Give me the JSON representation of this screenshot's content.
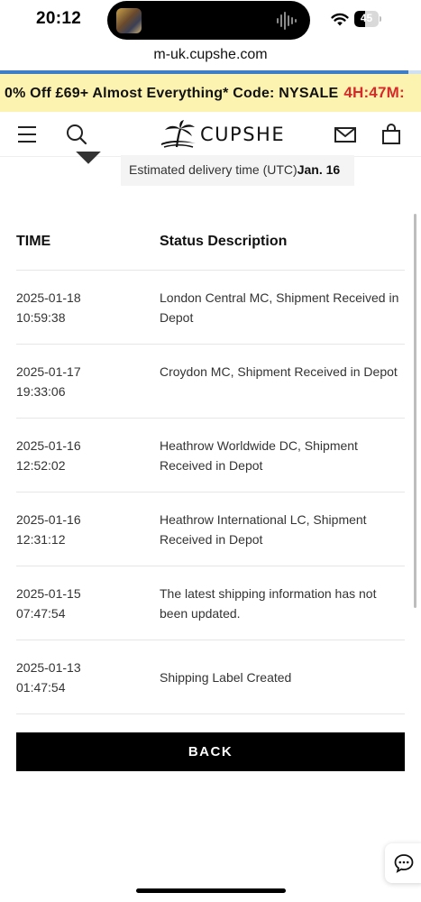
{
  "status_bar": {
    "time": "20:12",
    "battery_level": "45"
  },
  "browser": {
    "url": "m-uk.cupshe.com"
  },
  "promo": {
    "text": "0% Off £69+ Almost Everything* Code: NYSALE",
    "timer": "4H:47M:"
  },
  "header": {
    "menu_icon": "hamburger-menu-icon",
    "search_icon": "search-icon",
    "brand": "CUPSHE",
    "mail_icon": "mail-icon",
    "bag_icon": "shopping-bag-icon"
  },
  "delivery": {
    "label": "Estimated delivery time (UTC)",
    "date": "Jan. 16"
  },
  "tracking": {
    "columns": {
      "time": "TIME",
      "status": "Status Description"
    },
    "rows": [
      {
        "date": "2025-01-18",
        "clock": "10:59:38",
        "status": "London Central MC, Shipment Received in Depot"
      },
      {
        "date": "2025-01-17",
        "clock": "19:33:06",
        "status": "Croydon MC, Shipment Received in Depot"
      },
      {
        "date": "2025-01-16",
        "clock": "12:52:02",
        "status": "Heathrow Worldwide DC, Shipment Received in Depot"
      },
      {
        "date": "2025-01-16",
        "clock": "12:31:12",
        "status": "Heathrow International LC, Shipment Received in Depot"
      },
      {
        "date": "2025-01-15",
        "clock": "07:47:54",
        "status": "The latest shipping information has not been updated."
      },
      {
        "date": "2025-01-13",
        "clock": "01:47:54",
        "status": "Shipping Label Created"
      }
    ]
  },
  "actions": {
    "back_label": "BACK"
  },
  "chat": {
    "icon": "chat-bubble-icon"
  },
  "colors": {
    "promo_bg": "#fdf3b0",
    "timer": "#d62a2a",
    "button_bg": "#000000",
    "load_bar": "#3d7dc8"
  }
}
